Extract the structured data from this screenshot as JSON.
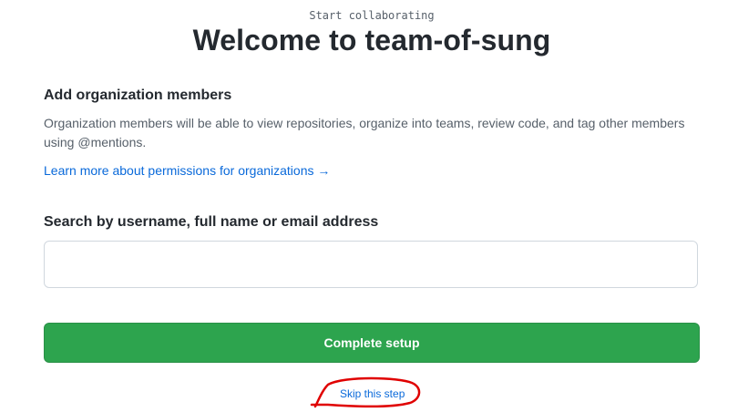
{
  "header": {
    "eyebrow": "Start collaborating",
    "title": "Welcome to team-of-sung"
  },
  "members_section": {
    "heading": "Add organization members",
    "description": "Organization members will be able to view repositories, organize into teams, review code, and tag other members using @mentions.",
    "learn_more_link": "Learn more about permissions for organizations →"
  },
  "search": {
    "label": "Search by username, full name or email address",
    "value": "",
    "placeholder": ""
  },
  "actions": {
    "complete_label": "Complete setup",
    "skip_label": "Skip this step"
  },
  "colors": {
    "primary_button": "#2da44e",
    "link": "#0969da",
    "annotation": "#e00000"
  }
}
